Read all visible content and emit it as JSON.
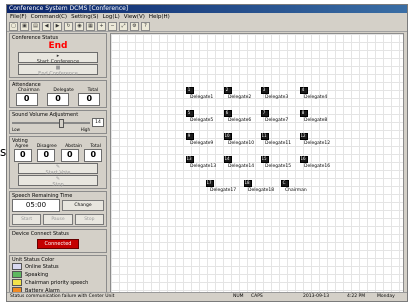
{
  "window": {
    "title": "Conference System DCMS [Conference]"
  },
  "menu": [
    "File(F)",
    "Command(C)",
    "Setting(S)",
    "Log(L)",
    "View(V)",
    "Help(H)"
  ],
  "toolbar_icons": [
    "new-icon",
    "open-icon",
    "save-icon",
    "back-icon",
    "forward-icon",
    "refresh-icon",
    "camera-icon",
    "grid-icon",
    "zoom-in-icon",
    "zoom-out-icon",
    "fit-icon",
    "settings-icon",
    "help-icon"
  ],
  "conference_status": {
    "label": "Conference Status",
    "value": "End",
    "start_btn": "Start Conference",
    "end_btn": "End Conference"
  },
  "attendance": {
    "label": "Attendance",
    "headers": [
      "Chairman",
      "Delegate",
      "Total"
    ],
    "values": [
      "0",
      "0",
      "0"
    ]
  },
  "sound_volume": {
    "label": "Sound Volume Adjustment",
    "value": "14",
    "low": "Low",
    "high": "High"
  },
  "voting": {
    "label": "Voting",
    "headers": [
      "Agree",
      "Disagree",
      "Abstain",
      "Total"
    ],
    "values": [
      "0",
      "0",
      "0",
      "0"
    ],
    "vote_btn": "Start Vote",
    "stop_btn": "Stop"
  },
  "speech_time": {
    "label": "Speech Remaining Time",
    "value": "05:00",
    "change_btn": "Change",
    "buttons": [
      "Start",
      "Pause",
      "Stop"
    ]
  },
  "device_connect": {
    "label": "Device Connect Status",
    "value": "Connected"
  },
  "unit_status": {
    "label": "Unit Status Color",
    "items": [
      {
        "label": "Online Status",
        "color": "#d8d8f0"
      },
      {
        "label": "Speaking",
        "color": "#5fb85f"
      },
      {
        "label": "Chairman priority speech",
        "color": "#f2e34c"
      },
      {
        "label": "Battery Alarm",
        "color": "#f08a24"
      },
      {
        "label": "Offline Status",
        "color": "#e9e9e9"
      }
    ]
  },
  "side_letter": "s",
  "delegates": [
    {
      "num": "1",
      "label": "Delegate1"
    },
    {
      "num": "2",
      "label": "Delegate2"
    },
    {
      "num": "3",
      "label": "Delegate3"
    },
    {
      "num": "4",
      "label": "Delegate4"
    },
    {
      "num": "5",
      "label": "Delegate5"
    },
    {
      "num": "6",
      "label": "Delegate6"
    },
    {
      "num": "7",
      "label": "Delegate7"
    },
    {
      "num": "8",
      "label": "Delegate8"
    },
    {
      "num": "9",
      "label": "Delegate9"
    },
    {
      "num": "10",
      "label": "Delegate10"
    },
    {
      "num": "11",
      "label": "Delegate11"
    },
    {
      "num": "12",
      "label": "Delegate12"
    },
    {
      "num": "13",
      "label": "Delegate13"
    },
    {
      "num": "14",
      "label": "Delegate14"
    },
    {
      "num": "15",
      "label": "Delegate15"
    },
    {
      "num": "16",
      "label": "Delegate16"
    },
    {
      "num": "17",
      "label": "Delegate17"
    },
    {
      "num": "18",
      "label": "Delegate18"
    },
    {
      "num": "C",
      "label": "Chairman"
    }
  ],
  "statusbar": {
    "left": "Status communication failure with Center Unit",
    "mode": "NUM",
    "caps": "CAPS",
    "date": "2013-09-13",
    "time": "4:22 PM",
    "day": "Monday"
  }
}
